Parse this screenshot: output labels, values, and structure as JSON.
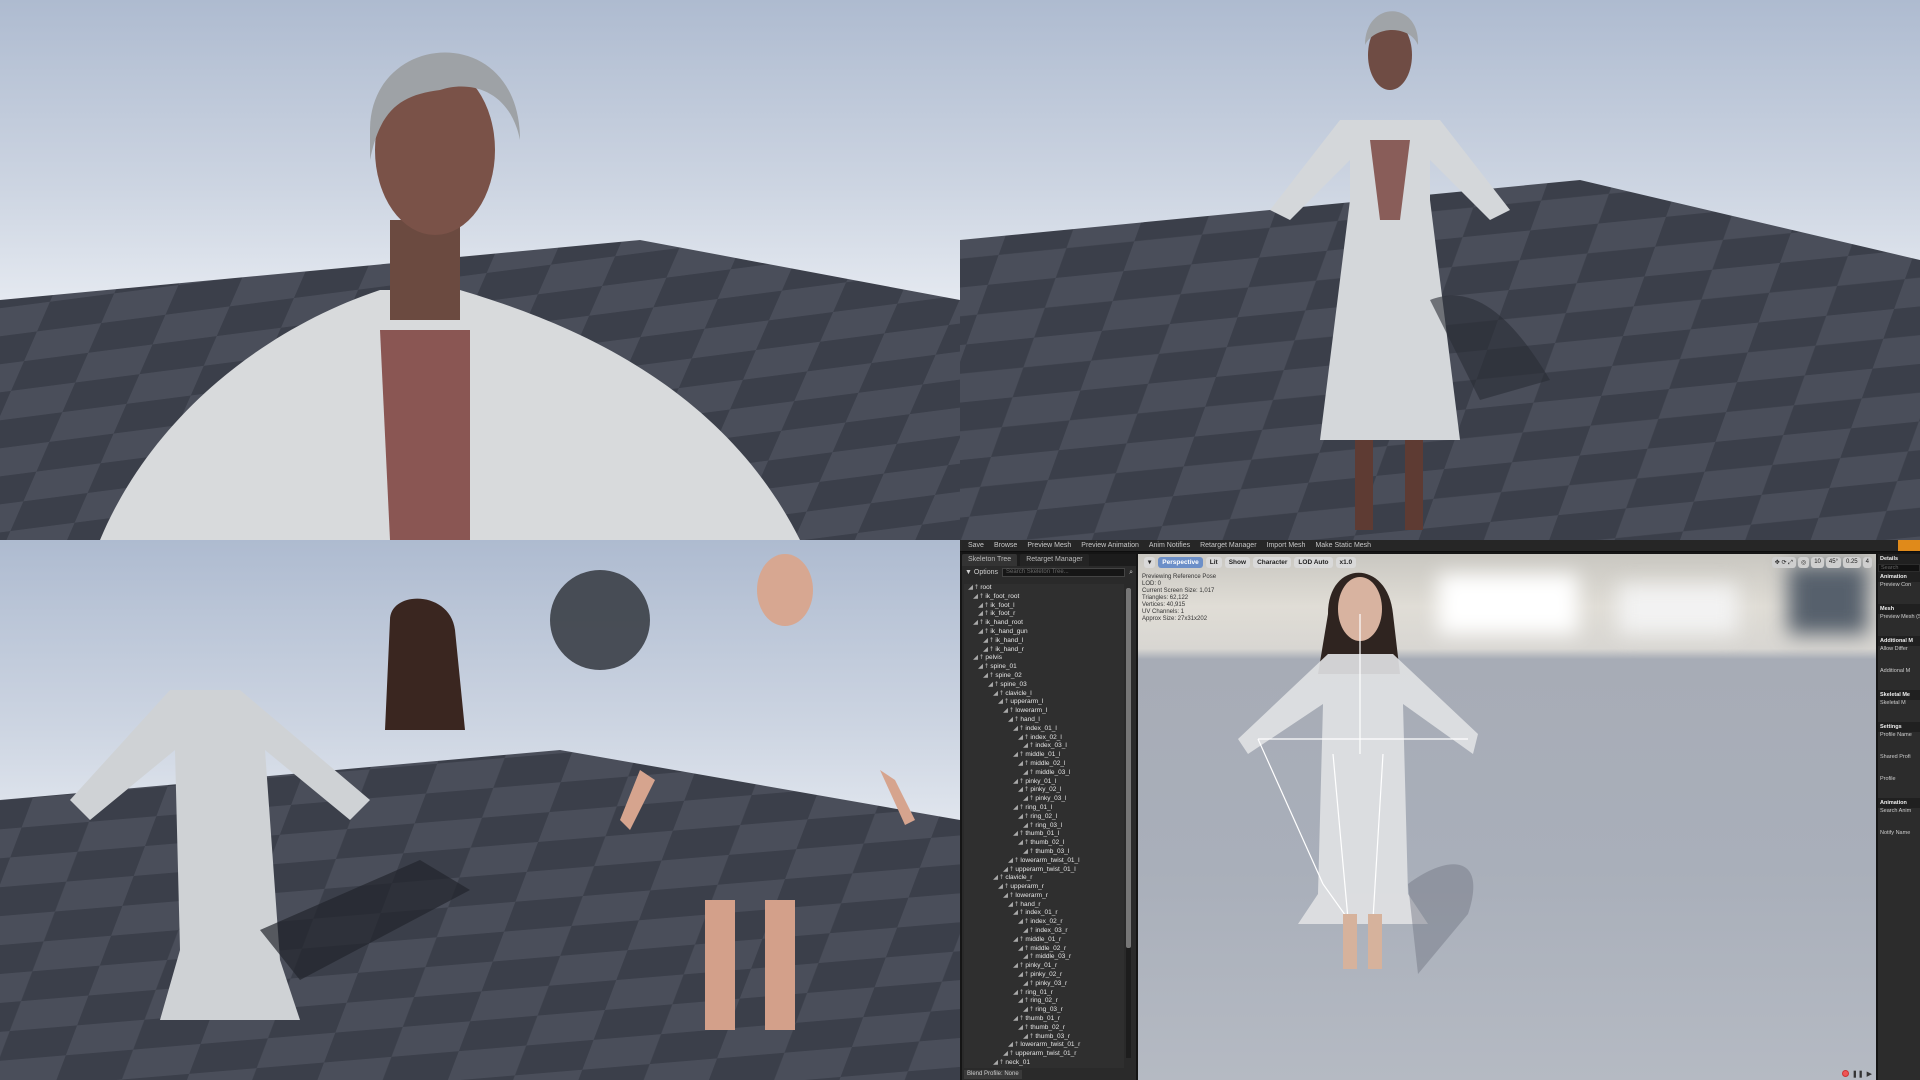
{
  "toolbar": {
    "items": [
      "Save",
      "Browse",
      "Preview Mesh",
      "Preview Animation",
      "Anim Notifies",
      "Retarget Manager",
      "Import Mesh",
      "Make Static Mesh"
    ]
  },
  "left_panel": {
    "tabs": [
      "Skeleton Tree",
      "Retarget Manager"
    ],
    "options_label": "Options",
    "search_placeholder": "Search Skeleton Tree...",
    "blend_profile": "Blend Profile: None"
  },
  "tree": [
    [
      "root",
      0
    ],
    [
      "ik_foot_root",
      1
    ],
    [
      "ik_foot_l",
      2
    ],
    [
      "ik_foot_r",
      2
    ],
    [
      "ik_hand_root",
      1
    ],
    [
      "ik_hand_gun",
      2
    ],
    [
      "ik_hand_l",
      3
    ],
    [
      "ik_hand_r",
      3
    ],
    [
      "pelvis",
      1
    ],
    [
      "spine_01",
      2
    ],
    [
      "spine_02",
      3
    ],
    [
      "spine_03",
      4
    ],
    [
      "clavicle_l",
      5
    ],
    [
      "upperarm_l",
      6
    ],
    [
      "lowerarm_l",
      7
    ],
    [
      "hand_l",
      8
    ],
    [
      "index_01_l",
      9
    ],
    [
      "index_02_l",
      10
    ],
    [
      "index_03_l",
      11
    ],
    [
      "middle_01_l",
      9
    ],
    [
      "middle_02_l",
      10
    ],
    [
      "middle_03_l",
      11
    ],
    [
      "pinky_01_l",
      9
    ],
    [
      "pinky_02_l",
      10
    ],
    [
      "pinky_03_l",
      11
    ],
    [
      "ring_01_l",
      9
    ],
    [
      "ring_02_l",
      10
    ],
    [
      "ring_03_l",
      11
    ],
    [
      "thumb_01_l",
      9
    ],
    [
      "thumb_02_l",
      10
    ],
    [
      "thumb_03_l",
      11
    ],
    [
      "lowerarm_twist_01_l",
      8
    ],
    [
      "upperarm_twist_01_l",
      7
    ],
    [
      "clavicle_r",
      5
    ],
    [
      "upperarm_r",
      6
    ],
    [
      "lowerarm_r",
      7
    ],
    [
      "hand_r",
      8
    ],
    [
      "index_01_r",
      9
    ],
    [
      "index_02_r",
      10
    ],
    [
      "index_03_r",
      11
    ],
    [
      "middle_01_r",
      9
    ],
    [
      "middle_02_r",
      10
    ],
    [
      "middle_03_r",
      11
    ],
    [
      "pinky_01_r",
      9
    ],
    [
      "pinky_02_r",
      10
    ],
    [
      "pinky_03_r",
      11
    ],
    [
      "ring_01_r",
      9
    ],
    [
      "ring_02_r",
      10
    ],
    [
      "ring_03_r",
      11
    ],
    [
      "thumb_01_r",
      9
    ],
    [
      "thumb_02_r",
      10
    ],
    [
      "thumb_03_r",
      11
    ],
    [
      "lowerarm_twist_01_r",
      8
    ],
    [
      "upperarm_twist_01_r",
      7
    ],
    [
      "neck_01",
      5
    ]
  ],
  "viewport": {
    "buttons": [
      "Perspective",
      "Lit",
      "Show",
      "Character",
      "LOD Auto",
      "x1.0"
    ],
    "stats": [
      "Previewing Reference Pose",
      "LOD: 0",
      "Current Screen Size: 1,017",
      "Triangles: 62,122",
      "Vertices: 40,915",
      "UV Channels: 1",
      "Approx Size: 27x31x202"
    ],
    "snap": {
      "grid": "10",
      "rotation": "45°",
      "scale": "0.25",
      "camera_speed": "4"
    }
  },
  "details": {
    "title": "Details",
    "search": "Search",
    "rows": [
      [
        "h",
        "Animation"
      ],
      [
        "r",
        "Preview Con"
      ],
      [
        "h",
        "Mesh"
      ],
      [
        "r",
        "Preview Mesh (Skeleton)"
      ],
      [
        "h",
        "Additional M"
      ],
      [
        "r",
        "Allow Differ"
      ],
      [
        "r",
        "Additional M"
      ],
      [
        "h",
        "Skeletal Me"
      ],
      [
        "r",
        "Skeletal M"
      ],
      [
        "h",
        "Settings"
      ],
      [
        "r",
        "Profile Name"
      ],
      [
        "r",
        "Shared Profi"
      ],
      [
        "r",
        "Profile"
      ],
      [
        "h",
        "Animation"
      ],
      [
        "r",
        "Search Anim"
      ],
      [
        "r",
        "Notify Name"
      ]
    ]
  },
  "colors": {
    "accent": "#e08a1a",
    "dress": "#d9dcdf",
    "floor_dark": "#3b3f4a",
    "floor_light": "#4a4e5a"
  }
}
